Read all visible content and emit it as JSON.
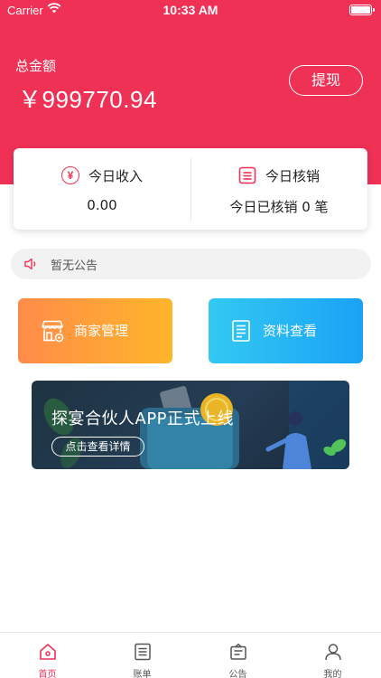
{
  "status_bar": {
    "carrier": "Carrier",
    "time": "10:33 AM"
  },
  "header": {
    "total_label": "总金额",
    "total_amount": "￥999770.94",
    "withdraw_label": "提现"
  },
  "stats": {
    "income": {
      "title": "今日收入",
      "value": "0.00",
      "icon": "yen-circle-icon"
    },
    "verification": {
      "title": "今日核销",
      "value": "今日已核销 0 笔",
      "icon": "list-icon"
    }
  },
  "notice": {
    "text": "暂无公告",
    "icon": "speaker-icon"
  },
  "tiles": [
    {
      "label": "商家管理",
      "icon": "store-icon"
    },
    {
      "label": "资料查看",
      "icon": "document-icon"
    }
  ],
  "banner": {
    "title": "探宴合伙人APP正式上线",
    "button_label": "点击查看详情"
  },
  "tabbar": {
    "items": [
      {
        "label": "首页",
        "icon": "home-icon",
        "active": true
      },
      {
        "label": "账单",
        "icon": "bill-icon",
        "active": false
      },
      {
        "label": "公告",
        "icon": "announcement-icon",
        "active": false
      },
      {
        "label": "我的",
        "icon": "user-icon",
        "active": false
      }
    ]
  },
  "colors": {
    "brand": "#ef3156",
    "merchant_tile": "#ff9f3a",
    "docs_tile": "#27b6f4",
    "banner_bg": "#1e3342"
  }
}
